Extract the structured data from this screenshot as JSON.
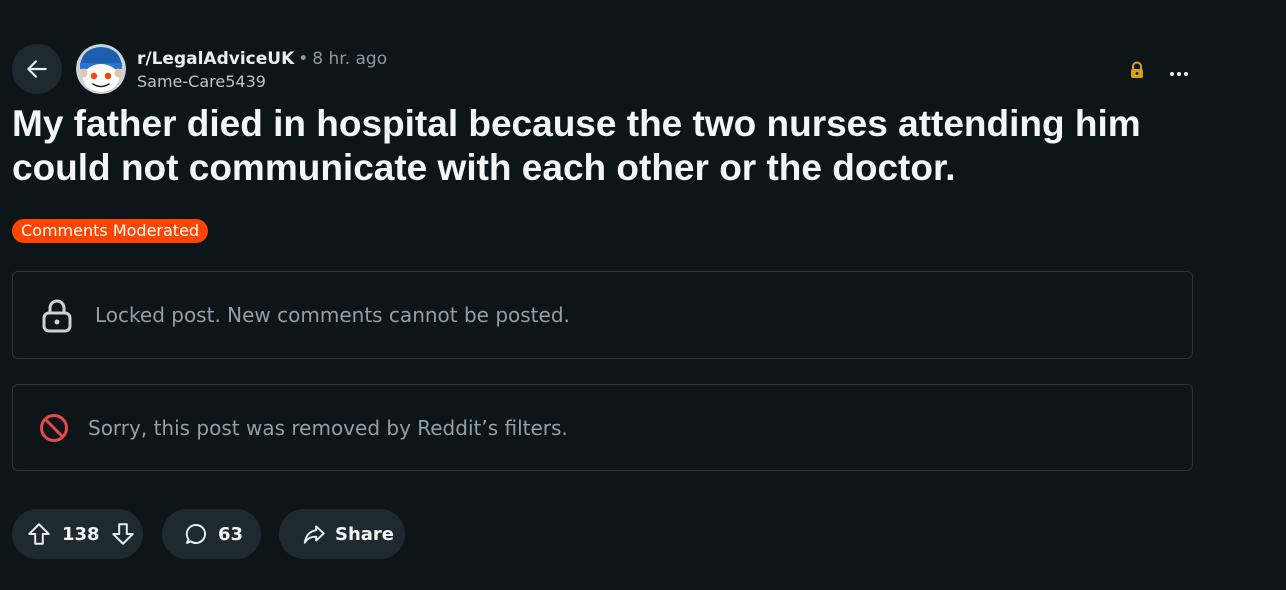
{
  "header": {
    "subreddit": "r/LegalAdviceUK",
    "separator": "•",
    "time_ago": "8 hr. ago",
    "author": "Same-Care5439"
  },
  "post": {
    "title": "My father died in hospital because the two nurses attending him could not communicate with each other or the doctor.",
    "flair": "Comments Moderated"
  },
  "notices": {
    "locked": "Locked post. New comments cannot be posted.",
    "removed": "Sorry, this post was removed by Reddit’s filters."
  },
  "actions": {
    "votes": "138",
    "comments": "63",
    "share": "Share"
  },
  "colors": {
    "background": "#0e1519",
    "flair": "#ff4500",
    "lock_gold": "#d4a017",
    "removed_red": "#e5484d"
  }
}
